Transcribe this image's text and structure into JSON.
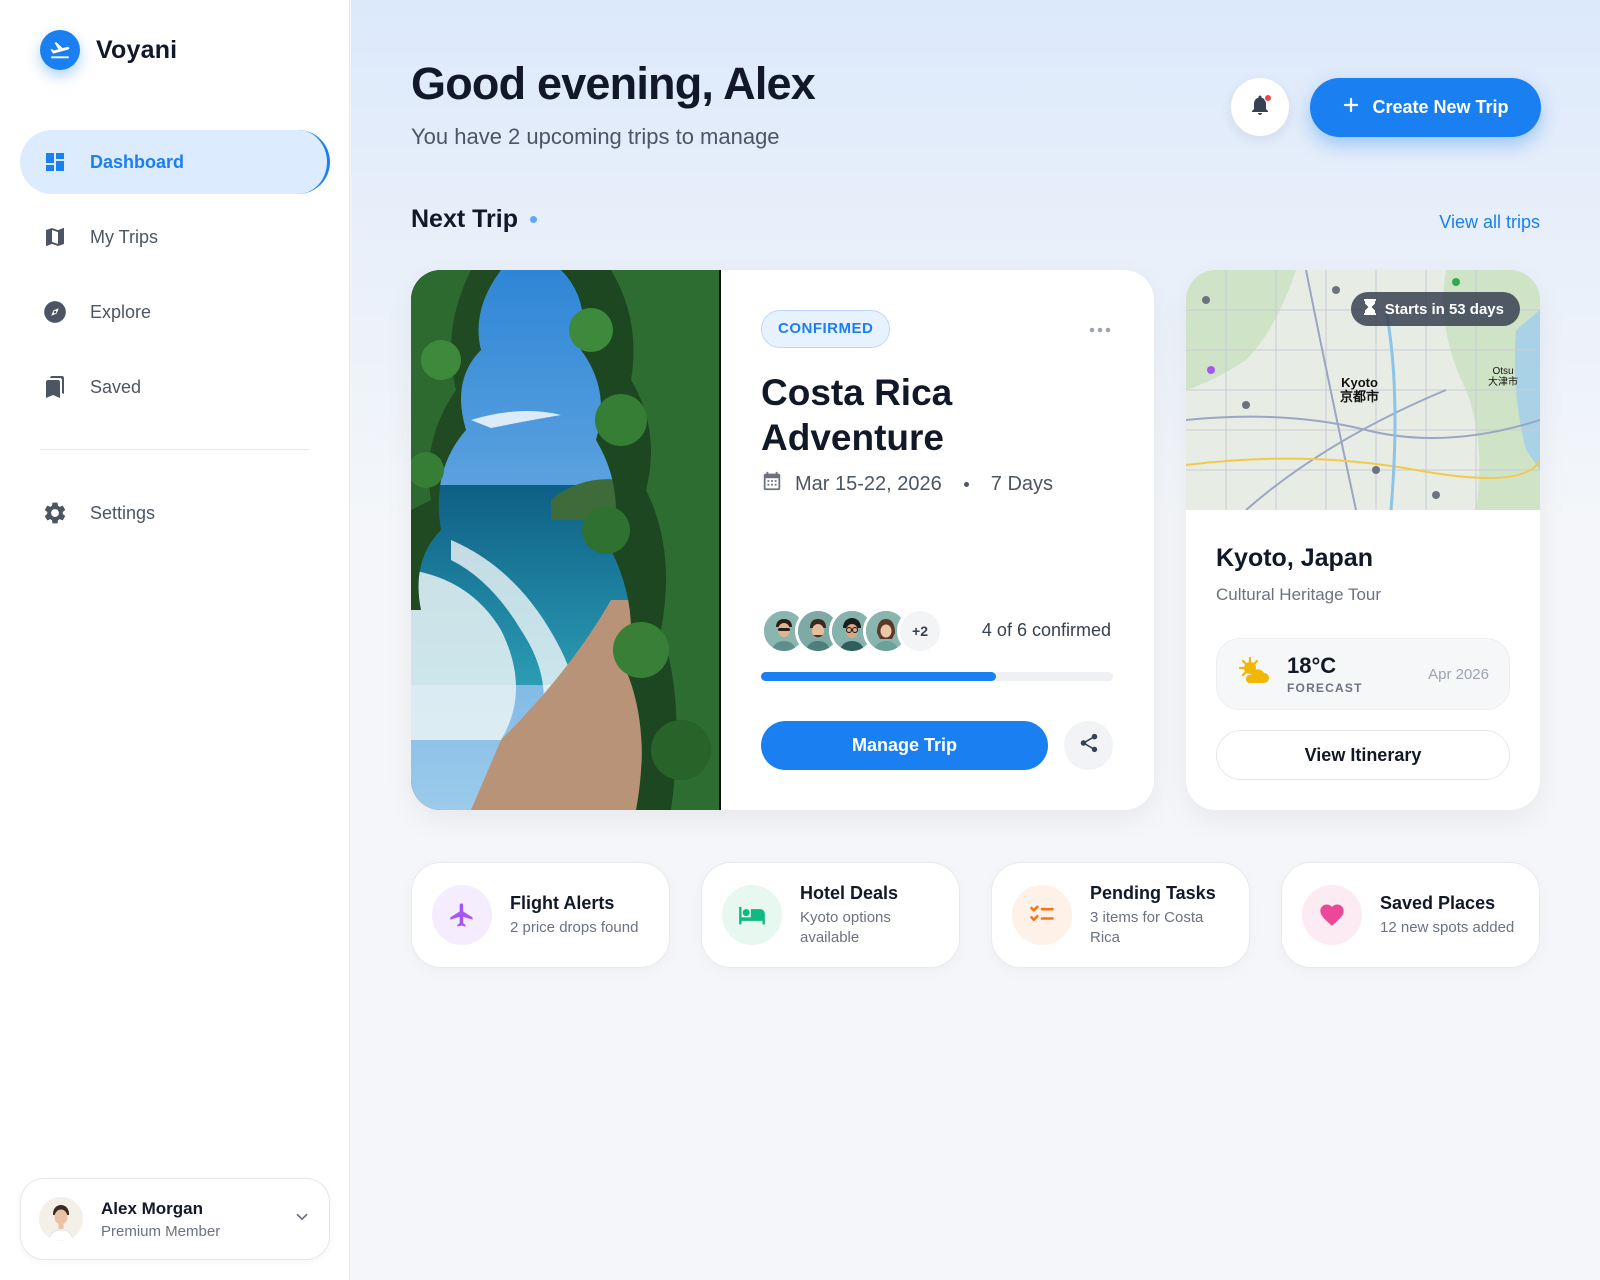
{
  "app": {
    "name": "Voyani"
  },
  "sidebar": {
    "items": [
      {
        "label": "Dashboard",
        "icon": "dashboard-icon",
        "active": true
      },
      {
        "label": "My Trips",
        "icon": "map-icon",
        "active": false
      },
      {
        "label": "Explore",
        "icon": "compass-icon",
        "active": false
      },
      {
        "label": "Saved",
        "icon": "bookmark-icon",
        "active": false
      }
    ],
    "settings": {
      "label": "Settings",
      "icon": "gear-icon"
    },
    "user": {
      "name": "Alex Morgan",
      "role": "Premium Member"
    }
  },
  "header": {
    "greeting": "Good evening, Alex",
    "subtitle": "You have 2 upcoming trips to manage",
    "create_label": "Create New Trip"
  },
  "next_trip": {
    "section_title": "Next Trip",
    "view_all": "View all trips",
    "status": "CONFIRMED",
    "title": "Costa Rica Adventure",
    "dates": "Mar 15-22, 2026",
    "duration": "7 Days",
    "extra_travelers": "+2",
    "confirmed_text": "4 of 6 confirmed",
    "confirmed_fraction": 0.667,
    "manage_label": "Manage Trip"
  },
  "upcoming_trip": {
    "countdown": "Starts in 53 days",
    "map_label_city": "Kyoto",
    "map_label_city_native": "京都市",
    "map_label_otsu": "Otsu",
    "map_label_otsu_native": "大津市",
    "name": "Kyoto, Japan",
    "subtitle": "Cultural Heritage Tour",
    "weather": {
      "temp": "18°C",
      "label": "FORECAST",
      "date": "Apr 2026"
    },
    "itinerary_label": "View Itinerary"
  },
  "quick_cards": [
    {
      "title": "Flight Alerts",
      "subtitle": "2 price drops found",
      "icon": "plane-icon",
      "color": "#a855f7",
      "bg": "#f5ecfe"
    },
    {
      "title": "Hotel Deals",
      "subtitle": "Kyoto options available",
      "icon": "bed-icon",
      "color": "#10b981",
      "bg": "#e7f8f1"
    },
    {
      "title": "Pending Tasks",
      "subtitle": "3 items for Costa Rica",
      "icon": "checklist-icon",
      "color": "#f97316",
      "bg": "#fef1e7"
    },
    {
      "title": "Saved Places",
      "subtitle": "12 new spots added",
      "icon": "heart-icon",
      "color": "#ec4899",
      "bg": "#fdebf3"
    }
  ],
  "colors": {
    "accent": "#1a7ff0",
    "text": "#111827",
    "muted": "#6b7280"
  }
}
